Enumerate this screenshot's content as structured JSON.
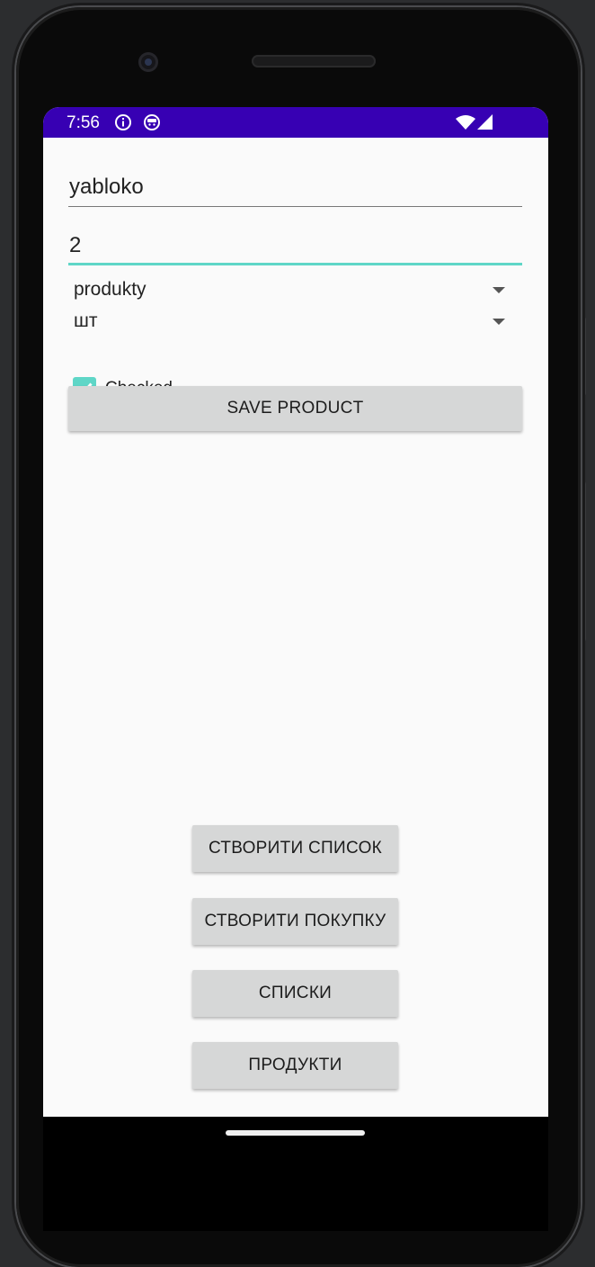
{
  "status_bar": {
    "time": "7:56",
    "icons": [
      "info-icon",
      "notification-icon",
      "wifi-icon",
      "cell-signal-icon"
    ],
    "color": "#3700b3"
  },
  "form": {
    "name_field": {
      "value": "yabloko"
    },
    "quantity_field": {
      "value": "2"
    },
    "category_spinner": {
      "selected": "produkty"
    },
    "unit_spinner": {
      "selected": "шт"
    },
    "checked_checkbox": {
      "label": "Checked",
      "checked": true
    },
    "save_button": {
      "label": "SAVE PRODUCT"
    }
  },
  "actions": {
    "create_list": "СТВОРИТИ СПИСОК",
    "create_purchase": "СТВОРИТИ ПОКУПКУ",
    "lists": "СПИСКИ",
    "products": "ПРОДУКТИ"
  },
  "colors": {
    "accent": "#5fd6c7",
    "button": "#d6d7d7",
    "background": "#fafafa"
  }
}
